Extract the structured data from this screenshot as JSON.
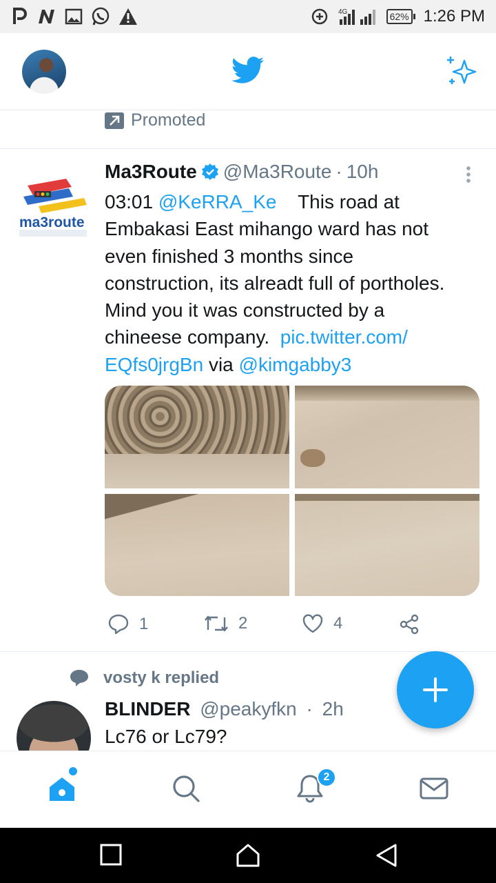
{
  "status_bar": {
    "time": "1:26 PM",
    "battery": "62%",
    "network": "4G"
  },
  "header": {
    "logo_icon": "twitter-bird-icon",
    "sparkle_icon": "sparkle-icon",
    "accent_color": "#1da1f2"
  },
  "promoted": {
    "label": "Promoted"
  },
  "tweet": {
    "name": "Ma3Route",
    "handle": "@Ma3Route",
    "dot": "·",
    "time": "10h",
    "lines": {
      "l1_prefix": "03:01 ",
      "l1_mention": "@KeRRA_Ke",
      "l1_suffix": "    This road at",
      "l2": "Embakasi East mihango ward has not",
      "l3": "even finished 3 months since",
      "l4": "construction, its alreadt full of portholes.",
      "l5": "Mind you it was constructed by a",
      "l6_prefix": "chineese company.  ",
      "l6_link": "pic.twitter.com/",
      "l7_link": "EQfs0jrgBn",
      "l7_via": " via ",
      "l7_mention": "@kimgabby3"
    },
    "logo_text": "ma3route",
    "counts": {
      "replies": "1",
      "retweets": "2",
      "likes": "4"
    }
  },
  "tweet2": {
    "context": "vosty k replied",
    "name": "BLINDER",
    "handle": "@peakyfkn",
    "dot": "·",
    "time": "2h",
    "text": "Lc76 or Lc79?"
  },
  "bottom_nav": {
    "notifications_badge": "2",
    "items": [
      "home-icon",
      "search-icon",
      "notifications-icon",
      "messages-icon"
    ]
  }
}
